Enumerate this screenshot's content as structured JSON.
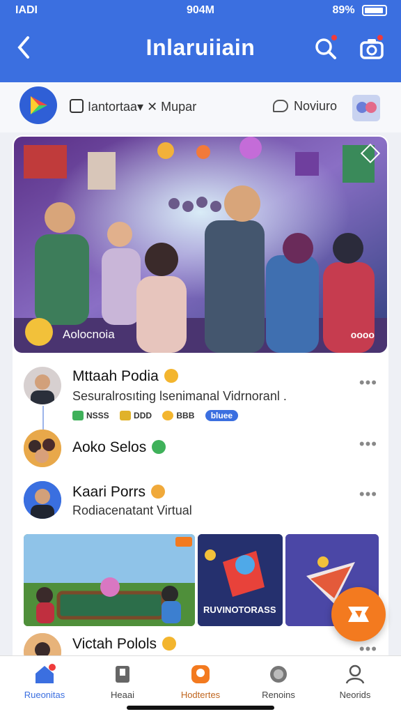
{
  "status_bar": {
    "carrier": "IADI",
    "time": "904M",
    "battery": "89%"
  },
  "header": {
    "title": "Inlaruiiain",
    "back_icon": "chevron-left-icon",
    "search_icon": "search-icon",
    "camera_icon": "camera-icon"
  },
  "quick_row": {
    "item1": "Iantortaa▾ ✕ Mupar",
    "item2": "Noviuro"
  },
  "banner": {
    "label": "Aolocnoia",
    "more": "oooo"
  },
  "feed": [
    {
      "name": "Mttaah Podia",
      "subtitle": "Sesuralrosıting lsenimanal Vidrnoranl .",
      "tags": [
        "NSSS",
        "DDD",
        "BBB"
      ],
      "tag_blue": "bluee"
    },
    {
      "name": "Aoko Selos"
    },
    {
      "name": "Kaari Porrs",
      "subtitle": "Rodiacenatant Virtual"
    },
    {
      "name": "Victah Polols"
    }
  ],
  "thumbs": {
    "middle_label": "RUVINOTORASS"
  },
  "bottom_nav": [
    {
      "label": "Rueonitas"
    },
    {
      "label": "Heaai"
    },
    {
      "label": "Hodtertes"
    },
    {
      "label": "Renoins"
    },
    {
      "label": "Neorids"
    }
  ],
  "colors": {
    "primary": "#3b6fe0",
    "accent": "#f37a1f",
    "badge": "#ef3b3b"
  }
}
